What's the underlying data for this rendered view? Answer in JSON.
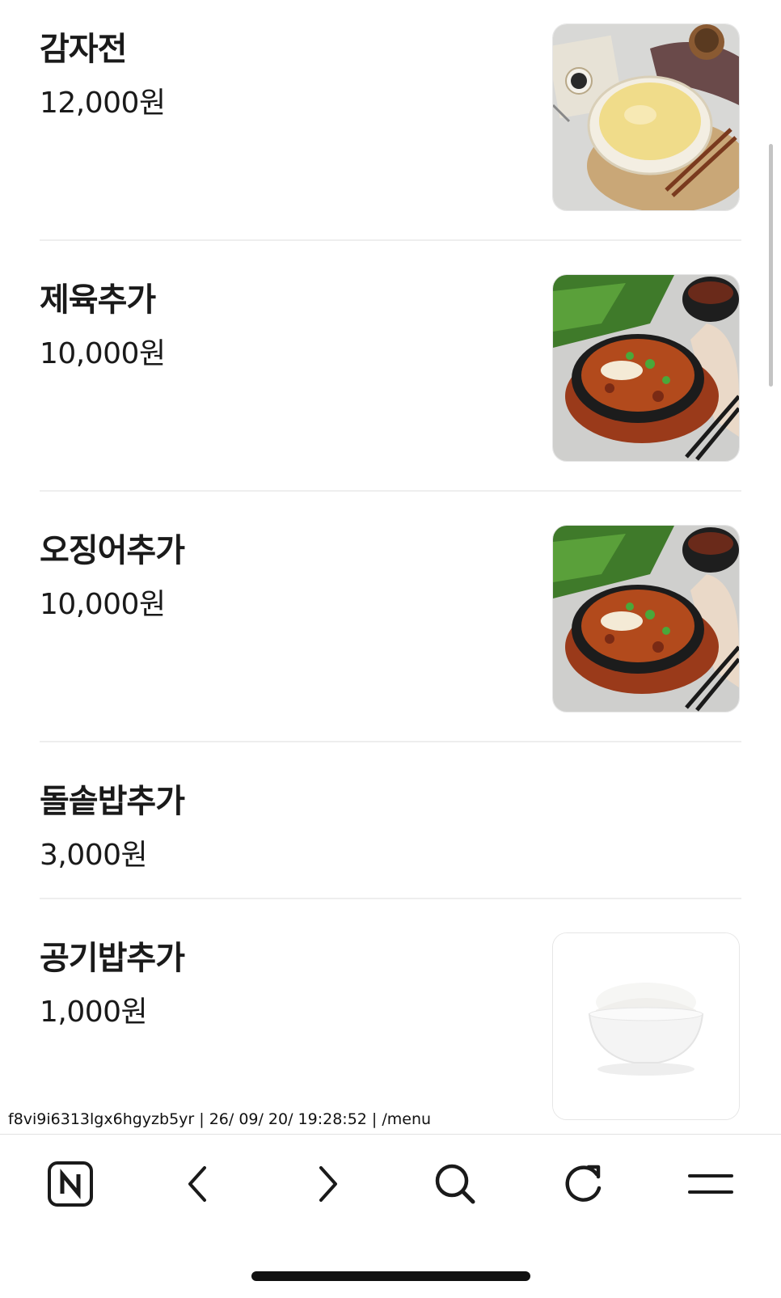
{
  "menu": {
    "items": [
      {
        "name": "감자전",
        "price": "12,000원",
        "image": "potato-pancake-image"
      },
      {
        "name": "제육추가",
        "price": "10,000원",
        "image": "spicy-pork-image"
      },
      {
        "name": "오징어추가",
        "price": "10,000원",
        "image": "spicy-pork-image"
      },
      {
        "name": "돌솥밥추가",
        "price": "3,000원",
        "image": ""
      },
      {
        "name": "공기밥추가",
        "price": "1,000원",
        "image": "rice-bowl-image"
      }
    ]
  },
  "debug_line": "f8vi9i6313lgx6hgyzb5yr | 26/ 09/ 20/ 19:28:52 | /menu",
  "toolbar": {
    "icons": [
      "naver-home-icon",
      "back-arrow-icon",
      "forward-arrow-icon",
      "search-icon",
      "refresh-icon",
      "menu-icon"
    ]
  },
  "colors": {
    "text": "#1a1a1a",
    "divider": "#eeeeee",
    "accent": "#111111"
  }
}
